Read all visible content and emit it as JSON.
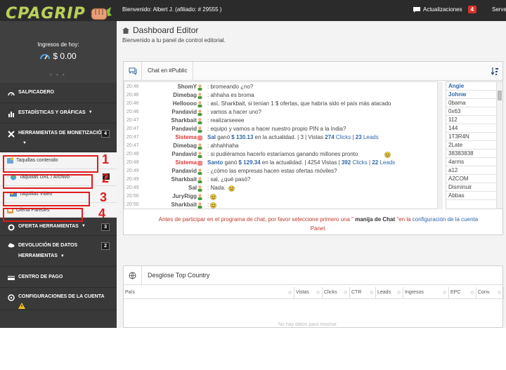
{
  "topbar": {
    "logo_text": "CPAGRIP",
    "welcome": "Bienvenido: Albert J. (afiliado: # 29555 )",
    "updates_label": "Actualizaciones",
    "updates_count": "4",
    "server_label": "Server"
  },
  "sidebar": {
    "earnings_label": "Ingresos de hoy:",
    "earnings_amount": "$ 0.00",
    "items": [
      {
        "label": "SALPICADERO",
        "icon": "speedometer-icon"
      },
      {
        "label": "ESTADÍSTICAS Y GRÁFICAS",
        "icon": "bar-chart-icon"
      },
      {
        "label": "HERRAMIENTAS DE MONETIZACIÓN",
        "icon": "tools-icon",
        "count": "4"
      },
      {
        "label": "OFERTA HERRAMIENTAS",
        "icon": "gear-icon",
        "count": "3"
      },
      {
        "label": "DEVOLUCIÓN DE DATOS",
        "label2": "HERRAMIENTAS",
        "icon": "cloud-icon",
        "count": "2"
      },
      {
        "label": "CENTRO DE PAGO",
        "icon": "card-icon"
      },
      {
        "label": "CONFIGURACIONES DE LA CUENTA",
        "icon": "settings-icon"
      }
    ],
    "subitems": [
      {
        "label": "Taquillas contenido"
      },
      {
        "label": "Taquillas URL / Archivo",
        "count": "2"
      },
      {
        "label": "Taquillas Video"
      },
      {
        "label": "Oferta Paredes"
      }
    ],
    "annotations": [
      "1",
      "2",
      "3",
      "4"
    ]
  },
  "main": {
    "title": "Dashboard Editor",
    "subtitle": "Bienvenido a tu panel de control editorial.",
    "chat_tab": "Chat en #Public",
    "messages": [
      {
        "time": "20:46",
        "user": "ShomY",
        "text": ": bromeando ¿no?"
      },
      {
        "time": "20:46",
        "user": "Dimebag",
        "text": ": ahhaha es broma"
      },
      {
        "time": "20:46",
        "user": "Helloooo",
        "text": ": así, Sharkbait, si tenían 1 $ ofertas, que habría sido el país más atacado"
      },
      {
        "time": "20:46",
        "user": "Pandavid",
        "text": ": vamos a hacer uno?"
      },
      {
        "time": "20:47",
        "user": "Sharkbait",
        "text": ": realizarseeee"
      },
      {
        "time": "20:47",
        "user": "Pandavid",
        "text": ": equipo y vamos a hacer nuestro propio PIN a la India?"
      },
      {
        "time": "20:47",
        "user": "Sistema",
        "system": true,
        "name": "Sal",
        "amount": "$ 130.13",
        "mid": "en la actualidad. | 3 | Vistas",
        "views": "274",
        "clicks": "Clicks",
        "sep": "|",
        "leads": "23",
        "leadsLbl": "Leads"
      },
      {
        "time": "20:47",
        "user": "Dimebag",
        "text": ": ahhahhaha"
      },
      {
        "time": "20:48",
        "user": "Pandavid",
        "text": ": si pudiéramos hacerlo estaríamos ganando millones pronto"
      },
      {
        "time": "20:48",
        "user": "Sistema",
        "system": true,
        "name": "Santo",
        "amount": "$ 129.34",
        "mid": "en la actualidad. | 4254 Vistas |",
        "views": "392",
        "clicks": "Clicks",
        "sep": "|",
        "leads": "22",
        "leadsLbl": "Leads"
      },
      {
        "time": "20:49",
        "user": "Pandavid",
        "text": ": ¿cómo las empresas hacen estas ofertas móviles?"
      },
      {
        "time": "20:49",
        "user": "Sharkbait",
        "text": ": sal, ¿qué pasó?"
      },
      {
        "time": "20:49",
        "user": "Sal",
        "text": ": Nada."
      },
      {
        "time": "20:50",
        "user": "JuryRigg",
        "text": ":"
      },
      {
        "time": "20:50",
        "user": "Sharkbait",
        "text": ":"
      }
    ],
    "ganó": "ganó",
    "users": [
      "Angie",
      "Johnw",
      "0bama",
      "0x63",
      "112",
      "144",
      "1T3R4N",
      "2Late",
      "38383838",
      "4arms",
      "a12",
      "A2COM",
      "Disminuir",
      "Abbas"
    ],
    "notice_pre": "Antes de participar en el programa de chat, por favor seleccione primero una \"",
    "notice_bold": " manija de Chat ",
    "notice_mid": "\"en la ",
    "notice_link": "configuración de la cuenta",
    "notice_end": "Panel.",
    "country_title": "Desglose Top Country",
    "columns": [
      "País",
      "Vistas",
      "Clicks",
      "CTR",
      "Leads",
      "Ingresos",
      "EPC",
      "Conv."
    ],
    "no_data": "No hay datos para mostrar"
  },
  "colors": {
    "accent": "#2f66a8",
    "annotation": "#e01b1b",
    "system": "#d33333"
  }
}
